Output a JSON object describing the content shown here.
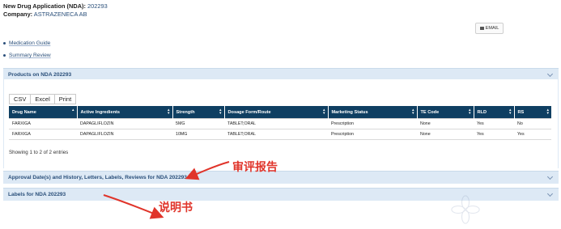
{
  "application": {
    "nda_label": "New Drug Application (NDA):",
    "nda_value": "202293",
    "company_label": "Company:",
    "company_value": "ASTRAZENECA AB"
  },
  "email_button": {
    "label": "EMAIL",
    "icon": "envelope-icon"
  },
  "links": [
    {
      "label": "Medication Guide"
    },
    {
      "label": "Summary Review"
    }
  ],
  "products_panel": {
    "title": "Products on NDA 202293",
    "export_buttons": [
      "CSV",
      "Excel",
      "Print"
    ],
    "columns": [
      "Drug Name",
      "Active Ingredients",
      "Strength",
      "Dosage Form/Route",
      "Marketing Status",
      "TE Code",
      "RLD",
      "RS"
    ],
    "rows": [
      [
        "FARXIGA",
        "DAPAGLIFLOZIN",
        "5MG",
        "TABLET;ORAL",
        "Prescription",
        "None",
        "Yes",
        "No"
      ],
      [
        "FARXIGA",
        "DAPAGLIFLOZIN",
        "10MG",
        "TABLET;ORAL",
        "Prescription",
        "None",
        "Yes",
        "Yes"
      ]
    ],
    "entries_text": "Showing 1 to 2 of 2 entries"
  },
  "approval_panel": {
    "title": "Approval Date(s) and History, Letters, Labels, Reviews for NDA 202293"
  },
  "labels_panel": {
    "title": "Labels for NDA 202293"
  },
  "annotations": {
    "review_report": "审评报告",
    "instructions": "说明书",
    "color": "#e0342a"
  },
  "colors": {
    "panel_header_bg": "#dde9f5",
    "table_header_bg": "#0f3f62",
    "link": "#2a4f7a"
  }
}
